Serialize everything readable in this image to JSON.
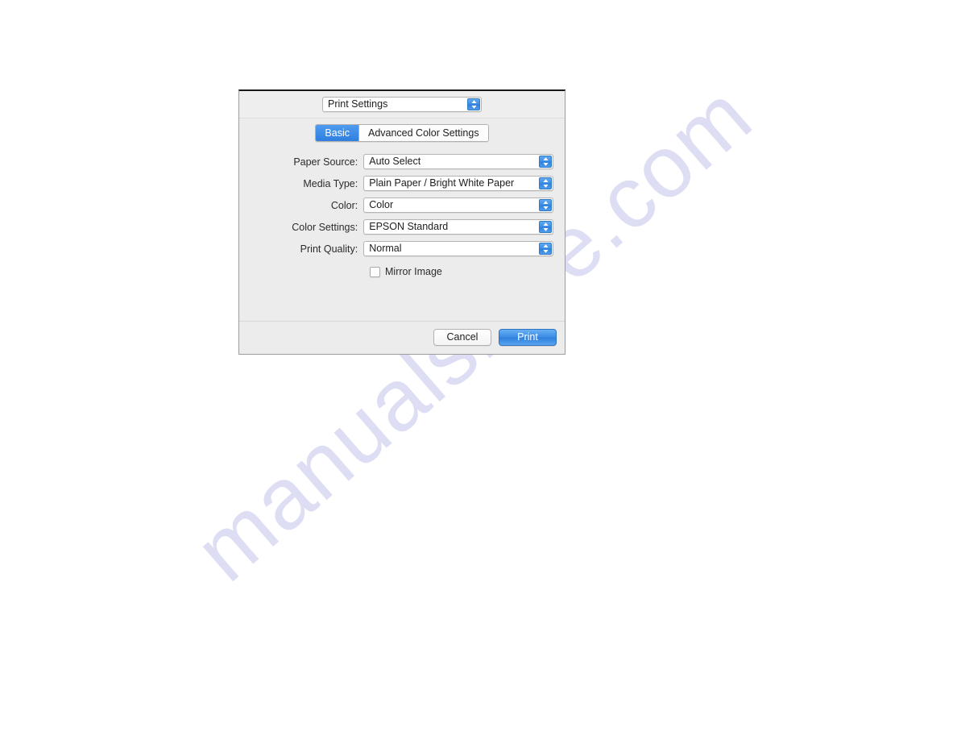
{
  "watermark": {
    "text": "manualshive.com"
  },
  "dialog": {
    "name": "print-settings-dialog",
    "header_popup": {
      "value": "Print Settings",
      "icon": "stepper-updown-icon"
    },
    "tabs": [
      {
        "label": "Basic",
        "selected": true
      },
      {
        "label": "Advanced Color Settings",
        "selected": false
      }
    ],
    "fields": [
      {
        "label": "Paper Source:",
        "value": "Auto Select",
        "name": "paper-source"
      },
      {
        "label": "Media Type:",
        "value": "Plain Paper / Bright White Paper",
        "name": "media-type"
      },
      {
        "label": "Color:",
        "value": "Color",
        "name": "color"
      },
      {
        "label": "Color Settings:",
        "value": "EPSON Standard",
        "name": "color-settings"
      },
      {
        "label": "Print Quality:",
        "value": "Normal",
        "name": "print-quality"
      }
    ],
    "checkbox": {
      "label": "Mirror Image",
      "checked": false
    },
    "buttons": {
      "cancel": "Cancel",
      "print": "Print"
    },
    "colors": {
      "accent": "#3d8de6",
      "dialog_background": "#ececec",
      "tab_selected": "#2f7fe0"
    }
  }
}
